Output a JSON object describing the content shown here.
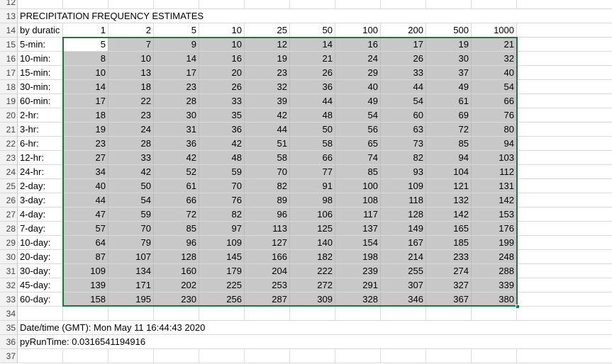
{
  "row_numbers": [
    "12",
    "13",
    "14",
    "15",
    "16",
    "17",
    "18",
    "19",
    "20",
    "21",
    "22",
    "23",
    "24",
    "25",
    "26",
    "27",
    "28",
    "29",
    "30",
    "31",
    "32",
    "33",
    "34",
    "35",
    "36",
    "37"
  ],
  "title": "PRECIPITATION FREQUENCY ESTIMATES",
  "header_label": "by duratic",
  "return_periods": [
    "1",
    "2",
    "5",
    "10",
    "25",
    "50",
    "100",
    "200",
    "500",
    "1000"
  ],
  "rows": [
    {
      "label": "5-min:",
      "values": [
        "5",
        "7",
        "9",
        "10",
        "12",
        "14",
        "16",
        "17",
        "19",
        "21"
      ]
    },
    {
      "label": "10-min:",
      "values": [
        "8",
        "10",
        "14",
        "16",
        "19",
        "21",
        "24",
        "26",
        "30",
        "32"
      ]
    },
    {
      "label": "15-min:",
      "values": [
        "10",
        "13",
        "17",
        "20",
        "23",
        "26",
        "29",
        "33",
        "37",
        "40"
      ]
    },
    {
      "label": "30-min:",
      "values": [
        "14",
        "18",
        "23",
        "26",
        "32",
        "36",
        "40",
        "44",
        "49",
        "54"
      ]
    },
    {
      "label": "60-min:",
      "values": [
        "17",
        "22",
        "28",
        "33",
        "39",
        "44",
        "49",
        "54",
        "61",
        "66"
      ]
    },
    {
      "label": "2-hr:",
      "values": [
        "18",
        "23",
        "30",
        "35",
        "42",
        "48",
        "54",
        "60",
        "69",
        "76"
      ]
    },
    {
      "label": "3-hr:",
      "values": [
        "19",
        "24",
        "31",
        "36",
        "44",
        "50",
        "56",
        "63",
        "72",
        "80"
      ]
    },
    {
      "label": "6-hr:",
      "values": [
        "23",
        "28",
        "36",
        "42",
        "51",
        "58",
        "65",
        "73",
        "85",
        "94"
      ]
    },
    {
      "label": "12-hr:",
      "values": [
        "27",
        "33",
        "42",
        "48",
        "58",
        "66",
        "74",
        "82",
        "94",
        "103"
      ]
    },
    {
      "label": "24-hr:",
      "values": [
        "34",
        "42",
        "52",
        "59",
        "70",
        "77",
        "85",
        "93",
        "104",
        "112"
      ]
    },
    {
      "label": "2-day:",
      "values": [
        "40",
        "50",
        "61",
        "70",
        "82",
        "91",
        "100",
        "109",
        "121",
        "131"
      ]
    },
    {
      "label": "3-day:",
      "values": [
        "44",
        "54",
        "66",
        "76",
        "89",
        "98",
        "108",
        "118",
        "132",
        "142"
      ]
    },
    {
      "label": "4-day:",
      "values": [
        "47",
        "59",
        "72",
        "82",
        "96",
        "106",
        "117",
        "128",
        "142",
        "153"
      ]
    },
    {
      "label": "7-day:",
      "values": [
        "57",
        "70",
        "85",
        "97",
        "113",
        "125",
        "137",
        "149",
        "165",
        "176"
      ]
    },
    {
      "label": "10-day:",
      "values": [
        "64",
        "79",
        "96",
        "109",
        "127",
        "140",
        "154",
        "167",
        "185",
        "199"
      ]
    },
    {
      "label": "20-day:",
      "values": [
        "87",
        "107",
        "128",
        "145",
        "166",
        "182",
        "198",
        "214",
        "233",
        "248"
      ]
    },
    {
      "label": "30-day:",
      "values": [
        "109",
        "134",
        "160",
        "179",
        "204",
        "222",
        "239",
        "255",
        "274",
        "288"
      ]
    },
    {
      "label": "45-day:",
      "values": [
        "139",
        "171",
        "202",
        "225",
        "253",
        "272",
        "291",
        "307",
        "327",
        "339"
      ]
    },
    {
      "label": "60-day:",
      "values": [
        "158",
        "195",
        "230",
        "256",
        "287",
        "309",
        "328",
        "346",
        "367",
        "380"
      ]
    }
  ],
  "footer": {
    "datetime_label": "Date/time (GMT):  Mon May 11 16:44:43 2020",
    "runtime_label": "pyRunTime:  0.0316541194916"
  },
  "colors": {
    "selection_fill": "#c8c8c8",
    "selection_border": "#217346",
    "header_bg": "#f2f2f2"
  }
}
